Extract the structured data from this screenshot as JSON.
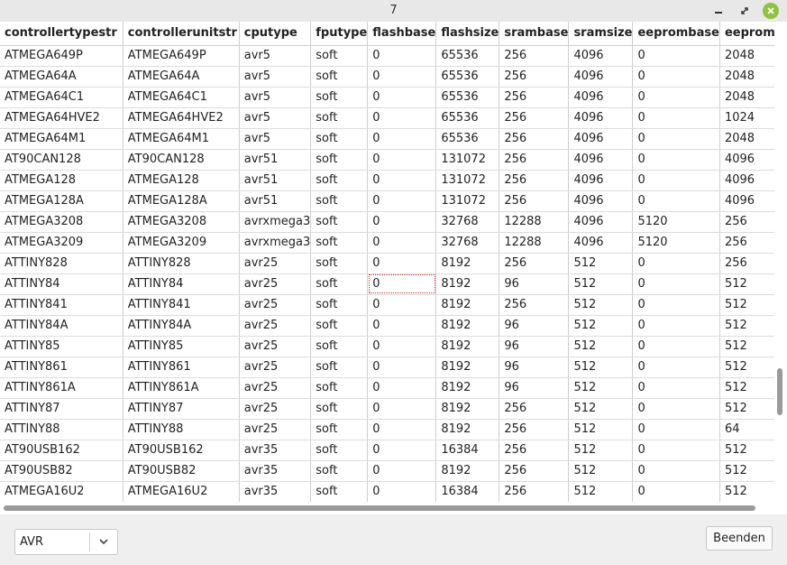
{
  "window": {
    "title": "7"
  },
  "table": {
    "columns": [
      "controllertypestr",
      "controllerunitstr",
      "cputype",
      "fputype",
      "flashbase",
      "flashsize",
      "srambase",
      "sramsize",
      "eeprombase",
      "eepromsi"
    ],
    "rows": [
      [
        "ATMEGA649P",
        "ATMEGA649P",
        "avr5",
        "soft",
        "0",
        "65536",
        "256",
        "4096",
        "0",
        "2048"
      ],
      [
        "ATMEGA64A",
        "ATMEGA64A",
        "avr5",
        "soft",
        "0",
        "65536",
        "256",
        "4096",
        "0",
        "2048"
      ],
      [
        "ATMEGA64C1",
        "ATMEGA64C1",
        "avr5",
        "soft",
        "0",
        "65536",
        "256",
        "4096",
        "0",
        "2048"
      ],
      [
        "ATMEGA64HVE2",
        "ATMEGA64HVE2",
        "avr5",
        "soft",
        "0",
        "65536",
        "256",
        "4096",
        "0",
        "1024"
      ],
      [
        "ATMEGA64M1",
        "ATMEGA64M1",
        "avr5",
        "soft",
        "0",
        "65536",
        "256",
        "4096",
        "0",
        "2048"
      ],
      [
        "AT90CAN128",
        "AT90CAN128",
        "avr51",
        "soft",
        "0",
        "131072",
        "256",
        "4096",
        "0",
        "4096"
      ],
      [
        "ATMEGA128",
        "ATMEGA128",
        "avr51",
        "soft",
        "0",
        "131072",
        "256",
        "4096",
        "0",
        "4096"
      ],
      [
        "ATMEGA128A",
        "ATMEGA128A",
        "avr51",
        "soft",
        "0",
        "131072",
        "256",
        "4096",
        "0",
        "4096"
      ],
      [
        "ATMEGA3208",
        "ATMEGA3208",
        "avrxmega3",
        "soft",
        "0",
        "32768",
        "12288",
        "4096",
        "5120",
        "256"
      ],
      [
        "ATMEGA3209",
        "ATMEGA3209",
        "avrxmega3",
        "soft",
        "0",
        "32768",
        "12288",
        "4096",
        "5120",
        "256"
      ],
      [
        "ATTINY828",
        "ATTINY828",
        "avr25",
        "soft",
        "0",
        "8192",
        "256",
        "512",
        "0",
        "256"
      ],
      [
        "ATTINY84",
        "ATTINY84",
        "avr25",
        "soft",
        "0",
        "8192",
        "96",
        "512",
        "0",
        "512"
      ],
      [
        "ATTINY841",
        "ATTINY841",
        "avr25",
        "soft",
        "0",
        "8192",
        "256",
        "512",
        "0",
        "512"
      ],
      [
        "ATTINY84A",
        "ATTINY84A",
        "avr25",
        "soft",
        "0",
        "8192",
        "96",
        "512",
        "0",
        "512"
      ],
      [
        "ATTINY85",
        "ATTINY85",
        "avr25",
        "soft",
        "0",
        "8192",
        "96",
        "512",
        "0",
        "512"
      ],
      [
        "ATTINY861",
        "ATTINY861",
        "avr25",
        "soft",
        "0",
        "8192",
        "96",
        "512",
        "0",
        "512"
      ],
      [
        "ATTINY861A",
        "ATTINY861A",
        "avr25",
        "soft",
        "0",
        "8192",
        "96",
        "512",
        "0",
        "512"
      ],
      [
        "ATTINY87",
        "ATTINY87",
        "avr25",
        "soft",
        "0",
        "8192",
        "256",
        "512",
        "0",
        "512"
      ],
      [
        "ATTINY88",
        "ATTINY88",
        "avr25",
        "soft",
        "0",
        "8192",
        "256",
        "512",
        "0",
        "64"
      ],
      [
        "AT90USB162",
        "AT90USB162",
        "avr35",
        "soft",
        "0",
        "16384",
        "256",
        "512",
        "0",
        "512"
      ],
      [
        "AT90USB82",
        "AT90USB82",
        "avr35",
        "soft",
        "0",
        "8192",
        "256",
        "512",
        "0",
        "512"
      ],
      [
        "ATMEGA16U2",
        "ATMEGA16U2",
        "avr35",
        "soft",
        "0",
        "16384",
        "256",
        "512",
        "0",
        "512"
      ]
    ],
    "selected_row": 11,
    "selected_col": 4
  },
  "footer": {
    "combo_value": "AVR",
    "close_label": "Beenden"
  }
}
